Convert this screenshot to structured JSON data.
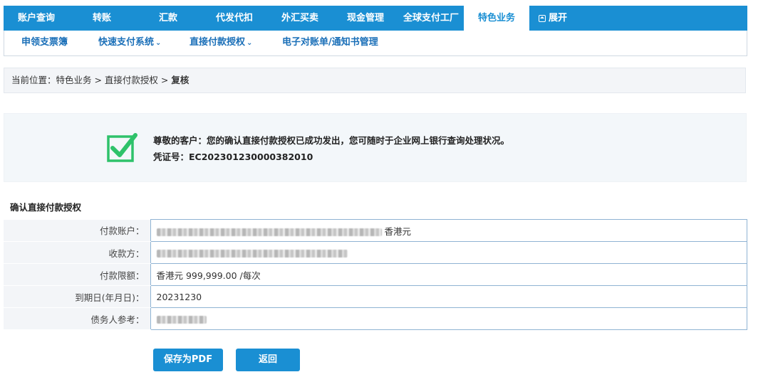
{
  "topnav": {
    "tabs": [
      {
        "label": "账户查询"
      },
      {
        "label": "转账"
      },
      {
        "label": "汇款"
      },
      {
        "label": "代发代扣"
      },
      {
        "label": "外汇买卖"
      },
      {
        "label": "现金管理"
      },
      {
        "label": "全球支付工厂"
      },
      {
        "label": "特色业务",
        "active": true
      }
    ],
    "expand_label": "展开"
  },
  "subnav": {
    "items": [
      {
        "label": "申领支票簿"
      },
      {
        "label": "快速支付系统"
      },
      {
        "label": "直接付款授权"
      },
      {
        "label": "电子对账单/通知书管理"
      }
    ]
  },
  "breadcrumb": {
    "prefix": "当前位置：特色业务 > 直接付款授权 > ",
    "current": "复核"
  },
  "notice": {
    "message": "尊敬的客户：您的确认直接付款授权已成功发出，您可随时于企业网上银行查询处理状况。",
    "voucher": "凭证号：EC202301230000382010"
  },
  "section": {
    "title": "确认直接付款授权"
  },
  "form": {
    "rows": [
      {
        "label": "付款账户：",
        "suffix": "香港元"
      },
      {
        "label": "收款方："
      },
      {
        "label": "付款限额：",
        "value": "香港元 999,999.00 /每次"
      },
      {
        "label": "到期日(年月日)：",
        "value": "20231230"
      },
      {
        "label": "债务人参考："
      }
    ]
  },
  "buttons": {
    "save_pdf": "保存为PDF",
    "back": "返回"
  },
  "colors": {
    "primary": "#1a8fd3",
    "success": "#2ec26a"
  }
}
